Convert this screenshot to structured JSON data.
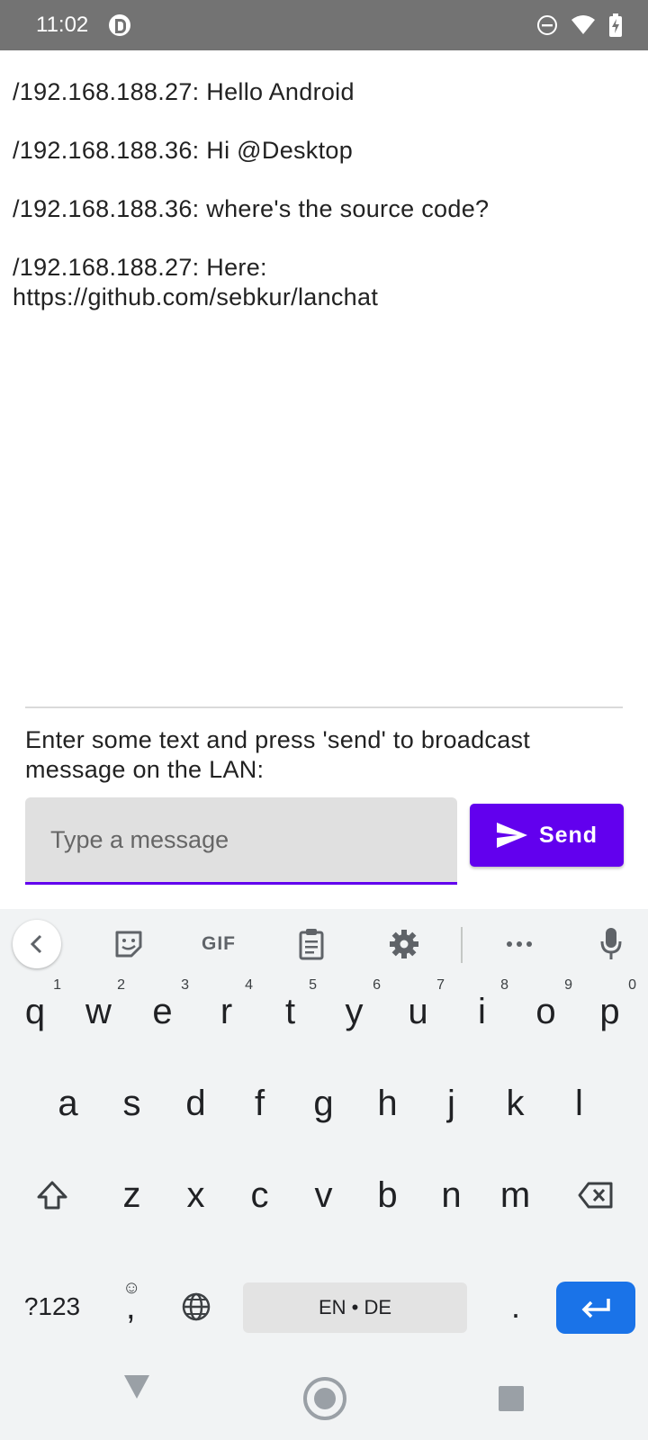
{
  "status_bar": {
    "time": "11:02",
    "app_icon": "pocket-casts-icon",
    "icons": [
      "do-not-disturb-icon",
      "wifi-icon",
      "battery-charging-icon"
    ]
  },
  "messages": [
    {
      "lines": [
        "/192.168.188.27: Hello Android"
      ]
    },
    {
      "lines": [
        "/192.168.188.36: Hi @Desktop"
      ]
    },
    {
      "lines": [
        "/192.168.188.36: where's the source code?"
      ]
    },
    {
      "lines": [
        "/192.168.188.27: Here:",
        "https://github.com/sebkur/lanchat"
      ]
    }
  ],
  "compose": {
    "instructions": "Enter some text and press 'send' to broadcast message on the LAN:",
    "input_value": "",
    "input_placeholder": "Type a message",
    "send_label": "Send",
    "accent_color": "#6200ee"
  },
  "keyboard": {
    "toolbar": {
      "back_icon": "chevron-left-icon",
      "gif_label": "GIF",
      "icons": [
        "sticker-icon",
        "gif-icon",
        "clipboard-icon",
        "gear-icon",
        "more-icon",
        "microphone-icon"
      ]
    },
    "row1": [
      {
        "label": "q",
        "hint": "1"
      },
      {
        "label": "w",
        "hint": "2"
      },
      {
        "label": "e",
        "hint": "3"
      },
      {
        "label": "r",
        "hint": "4"
      },
      {
        "label": "t",
        "hint": "5"
      },
      {
        "label": "y",
        "hint": "6"
      },
      {
        "label": "u",
        "hint": "7"
      },
      {
        "label": "i",
        "hint": "8"
      },
      {
        "label": "o",
        "hint": "9"
      },
      {
        "label": "p",
        "hint": "0"
      }
    ],
    "row2": [
      "a",
      "s",
      "d",
      "f",
      "g",
      "h",
      "j",
      "k",
      "l"
    ],
    "row3": [
      "z",
      "x",
      "c",
      "v",
      "b",
      "n",
      "m"
    ],
    "symbols_label": "?123",
    "emoji_hint": "☺",
    "comma_label": ",",
    "space_label": "EN • DE",
    "period_label": ".",
    "enter_color": "#1a73e8"
  },
  "nav_bar": {
    "icons": [
      "back-triangle-icon",
      "home-circle-icon",
      "recents-square-icon"
    ]
  }
}
